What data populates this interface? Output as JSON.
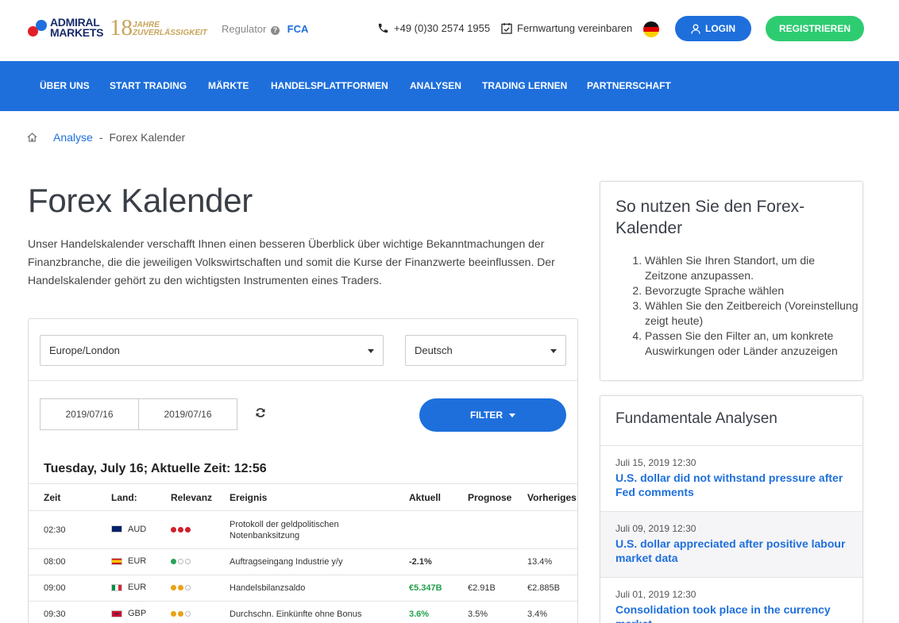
{
  "brand": {
    "line1": "ADMIRAL",
    "line2": "MARKETS",
    "anniversary_num": "18",
    "anniversary_line1": "JAHRE",
    "anniversary_line2": "ZUVERLÄSSIGKEIT"
  },
  "header": {
    "regulator_label": "Regulator",
    "regulator_value": "FCA",
    "phone": "+49 (0)30 2574 1955",
    "remote": "Fernwartung vereinbaren",
    "login": "LOGIN",
    "register": "REGISTRIEREN"
  },
  "nav": [
    "ÜBER UNS",
    "START TRADING",
    "MÄRKTE",
    "HANDELSPLATTFORMEN",
    "ANALYSEN",
    "TRADING LERNEN",
    "PARTNERSCHAFT"
  ],
  "breadcrumb": {
    "link": "Analyse",
    "separator": "-",
    "current": "Forex Kalender"
  },
  "page": {
    "title": "Forex Kalender",
    "intro": "Unser Handelskalender verschafft Ihnen einen besseren Überblick über wichtige Bekanntmachungen der Finanzbranche, die die jeweiligen Volkswirtschaften und somit die Kurse der Finanzwerte beeinflussen. Der Handelskalender gehört zu den wichtigsten Instrumenten eines Traders."
  },
  "calendar": {
    "timezone": "Europe/London",
    "language": "Deutsch",
    "date_from": "2019/07/16",
    "date_to": "2019/07/16",
    "filter_label": "FILTER",
    "current_date": "Tuesday, July 16; Aktuelle Zeit: 12:56",
    "columns": [
      "Zeit",
      "Land:",
      "Relevanz",
      "Ereignis",
      "Aktuell",
      "Prognose",
      "Vorheriges"
    ],
    "rows": [
      {
        "time": "02:30",
        "currency": "AUD",
        "relevance": 3,
        "event": "Protokoll der geldpolitischen Notenbanksitzung",
        "actual": "",
        "forecast": "",
        "previous": ""
      },
      {
        "time": "08:00",
        "currency": "EUR",
        "relevance": 1,
        "event": "Auftragseingang Industrie y/y",
        "actual": "-2.1%",
        "forecast": "",
        "previous": "13.4%"
      },
      {
        "time": "09:00",
        "currency": "EUR",
        "relevance": 2,
        "event": "Handelsbilanzsaldo",
        "actual": "€5.347B",
        "forecast": "€2.91B",
        "previous": "€2.885B"
      },
      {
        "time": "09:30",
        "currency": "GBP",
        "relevance": 2,
        "event": "Durchschn. Einkünfte ohne Bonus",
        "actual": "3.6%",
        "forecast": "3.5%",
        "previous": "3.4%"
      }
    ]
  },
  "howto": {
    "title": "So nutzen Sie den Forex-Kalender",
    "steps": [
      "Wählen Sie Ihren Standort, um die Zeitzone anzupassen.",
      "Bevorzugte Sprache wählen",
      "Wählen Sie den Zeitbereich (Voreinstellung zeigt heute)",
      "Passen Sie den Filter an, um konkrete Auswirkungen oder Länder anzuzeigen"
    ]
  },
  "fundamental": {
    "title": "Fundamentale Analysen",
    "items": [
      {
        "date": "Juli 15, 2019 12:30",
        "headline": "U.S. dollar did not withstand pressure after Fed comments"
      },
      {
        "date": "Juli 09, 2019 12:30",
        "headline": "U.S. dollar appreciated after positive labour market data"
      },
      {
        "date": "Juli 01, 2019 12:30",
        "headline": "Consolidation took place in the currency market"
      }
    ]
  },
  "colors": {
    "brand_blue": "#1e6fdc",
    "register_green": "#2ecc71",
    "positive": "#22a04b",
    "relevance_high": "#d0202e",
    "relevance_mid": "#e8a317",
    "relevance_low": "#27a35a"
  }
}
